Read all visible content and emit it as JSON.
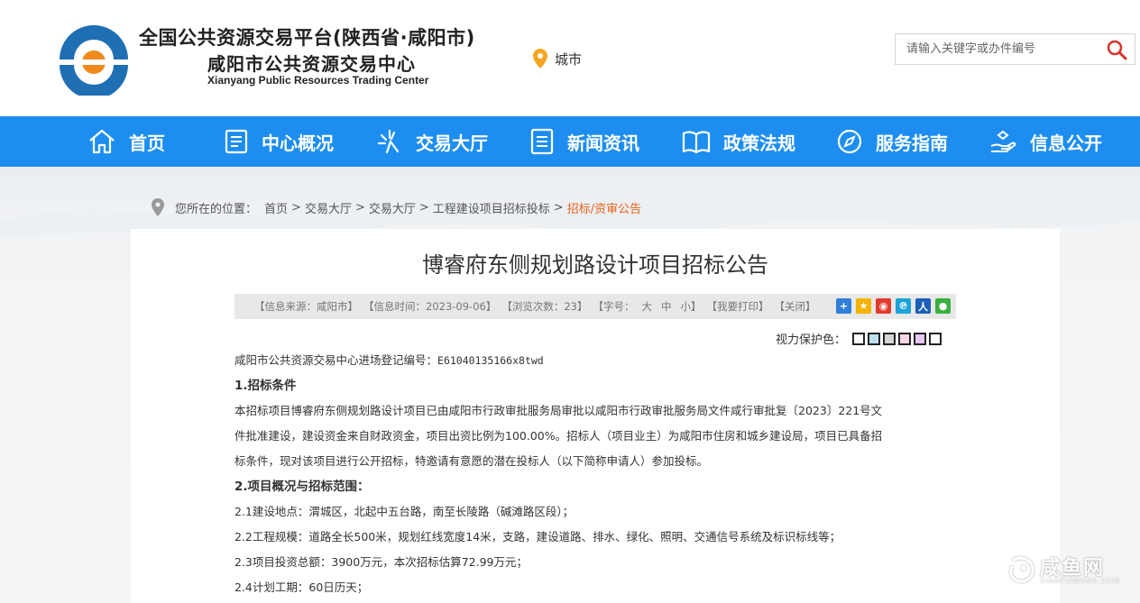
{
  "header": {
    "title_line1": "全国公共资源交易平台(陕西省·咸阳市)",
    "title_line2": "咸阳市公共资源交易中心",
    "title_line3": "Xianyang Public Resources Trading Center",
    "city_label": "城市",
    "search_placeholder": "请输入关键字或办件编号"
  },
  "nav": {
    "items": [
      {
        "label": "首页",
        "icon": "home-icon"
      },
      {
        "label": "中心概况",
        "icon": "document-icon"
      },
      {
        "label": "交易大厅",
        "icon": "sparkle-icon"
      },
      {
        "label": "新闻资讯",
        "icon": "list-icon"
      },
      {
        "label": "政策法规",
        "icon": "book-icon"
      },
      {
        "label": "服务指南",
        "icon": "compass-icon"
      },
      {
        "label": "信息公开",
        "icon": "hand-icon"
      }
    ]
  },
  "breadcrumb": {
    "lead": "您所在的位置：",
    "items": [
      "首页",
      "交易大厅",
      "交易大厅",
      "工程建设项目招标投标"
    ],
    "separator": ">",
    "current": "招标/资审公告"
  },
  "article": {
    "title": "博睿府东侧规划路设计项目招标公告",
    "info": {
      "source": "【信息来源：咸阳市】",
      "time": "【信息时间：2023-09-06】",
      "views": "【浏览次数：23】",
      "font_lead": "【字号：",
      "font_large": "大",
      "font_medium": "中",
      "font_small": "小】",
      "print": "【我要打印】",
      "close": "【关闭】"
    },
    "vision_label": "视力保护色：",
    "vision_colors": [
      "#ffffff",
      "#bce0f0",
      "#d6d6d6",
      "#f7d6e6",
      "#e6c8f0",
      "#ffffff"
    ],
    "reg_prefix": "咸阳市公共资源交易中心进场登记编号：",
    "reg_no": "E61040135166x8twd",
    "sec1_heading": "1.招标条件",
    "sec1_line1": "本招标项目博睿府东侧规划路设计项目已由咸阳市行政审批服务局审批以咸阳市行政审批服务局文件咸行审批复〔2023〕221号文",
    "sec1_line2": "件批准建设，建设资金来自财政资金，项目出资比例为100.00%。招标人（项目业主）为咸阳市住房和城乡建设局，项目已具备招",
    "sec1_line3": "标条件，现对该项目进行公开招标，特邀请有意愿的潜在投标人（以下简称申请人）参加投标。",
    "sec2_heading": "2.项目概况与招标范围：",
    "sec2_1": "2.1建设地点：渭城区，北起中五台路，南至长陵路（碱滩路区段）；",
    "sec2_2": "2.2工程规模：道路全长500米，规划红线宽度14米，支路，建设道路、排水、绿化、照明、交通信号系统及标识标线等；",
    "sec2_3": "2.3项目投资总额：3900万元，本次招标估算72.99万元；",
    "sec2_4": "2.4计划工期：60日历天；"
  },
  "watermark": {
    "text": "咸鱼网",
    "sub": "XIANYUWANG.COM"
  },
  "colors": {
    "nav_blue": "#1d8ef0",
    "logo_blue": "#1f6fb5",
    "logo_orange": "#f08a1c",
    "breadcrumb_current": "#e8621a"
  }
}
